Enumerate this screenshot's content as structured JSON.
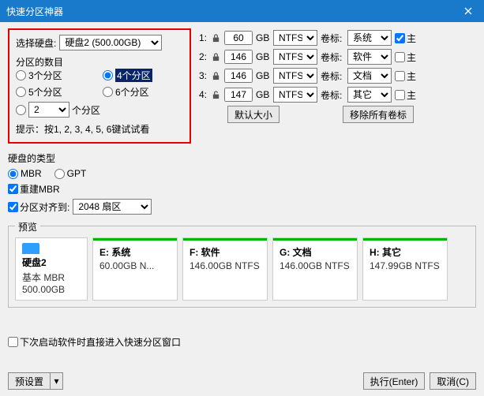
{
  "window": {
    "title": "快速分区神器"
  },
  "redbox": {
    "disk_label": "选择硬盘:",
    "disk_value": "硬盘2 (500.00GB)",
    "count_label": "分区的数目",
    "r3": "3个分区",
    "r4": "4个分区",
    "r5": "5个分区",
    "r6": "6个分区",
    "custom_n": "2",
    "custom_suffix": "个分区",
    "tips": "提示：按1, 2, 3, 4, 5, 6键试试看"
  },
  "pt": {
    "gb": "GB",
    "vol_label": "卷标:",
    "primary": "主",
    "rows": [
      {
        "n": "1:",
        "locked": true,
        "size": "60",
        "fs": "NTFS",
        "vol": "系统",
        "primary": true
      },
      {
        "n": "2:",
        "locked": true,
        "size": "146",
        "fs": "NTFS",
        "vol": "软件",
        "primary": false
      },
      {
        "n": "3:",
        "locked": true,
        "size": "146",
        "fs": "NTFS",
        "vol": "文档",
        "primary": false
      },
      {
        "n": "4:",
        "locked": false,
        "size": "147",
        "fs": "NTFS",
        "vol": "其它",
        "primary": false
      }
    ],
    "btn_default": "默认大小",
    "btn_clear": "移除所有卷标"
  },
  "mid": {
    "type_label": "硬盘的类型",
    "mbr": "MBR",
    "gpt": "GPT",
    "rebuild": "重建MBR",
    "align": "分区对齐到:",
    "align_val": "2048 扇区"
  },
  "preview": {
    "title": "预览",
    "disk": {
      "name": "硬盘2",
      "type": "基本 MBR",
      "size": "500.00GB"
    },
    "parts": [
      {
        "name": "E: 系统",
        "info": "60.00GB N..."
      },
      {
        "name": "F: 软件",
        "info": "146.00GB NTFS"
      },
      {
        "name": "G: 文档",
        "info": "146.00GB NTFS"
      },
      {
        "name": "H: 其它",
        "info": "147.99GB NTFS"
      }
    ]
  },
  "bottom": {
    "next_boot": "下次启动软件时直接进入快速分区窗口",
    "preset": "预设置",
    "ok": "执行(Enter)",
    "cancel": "取消(C)"
  }
}
